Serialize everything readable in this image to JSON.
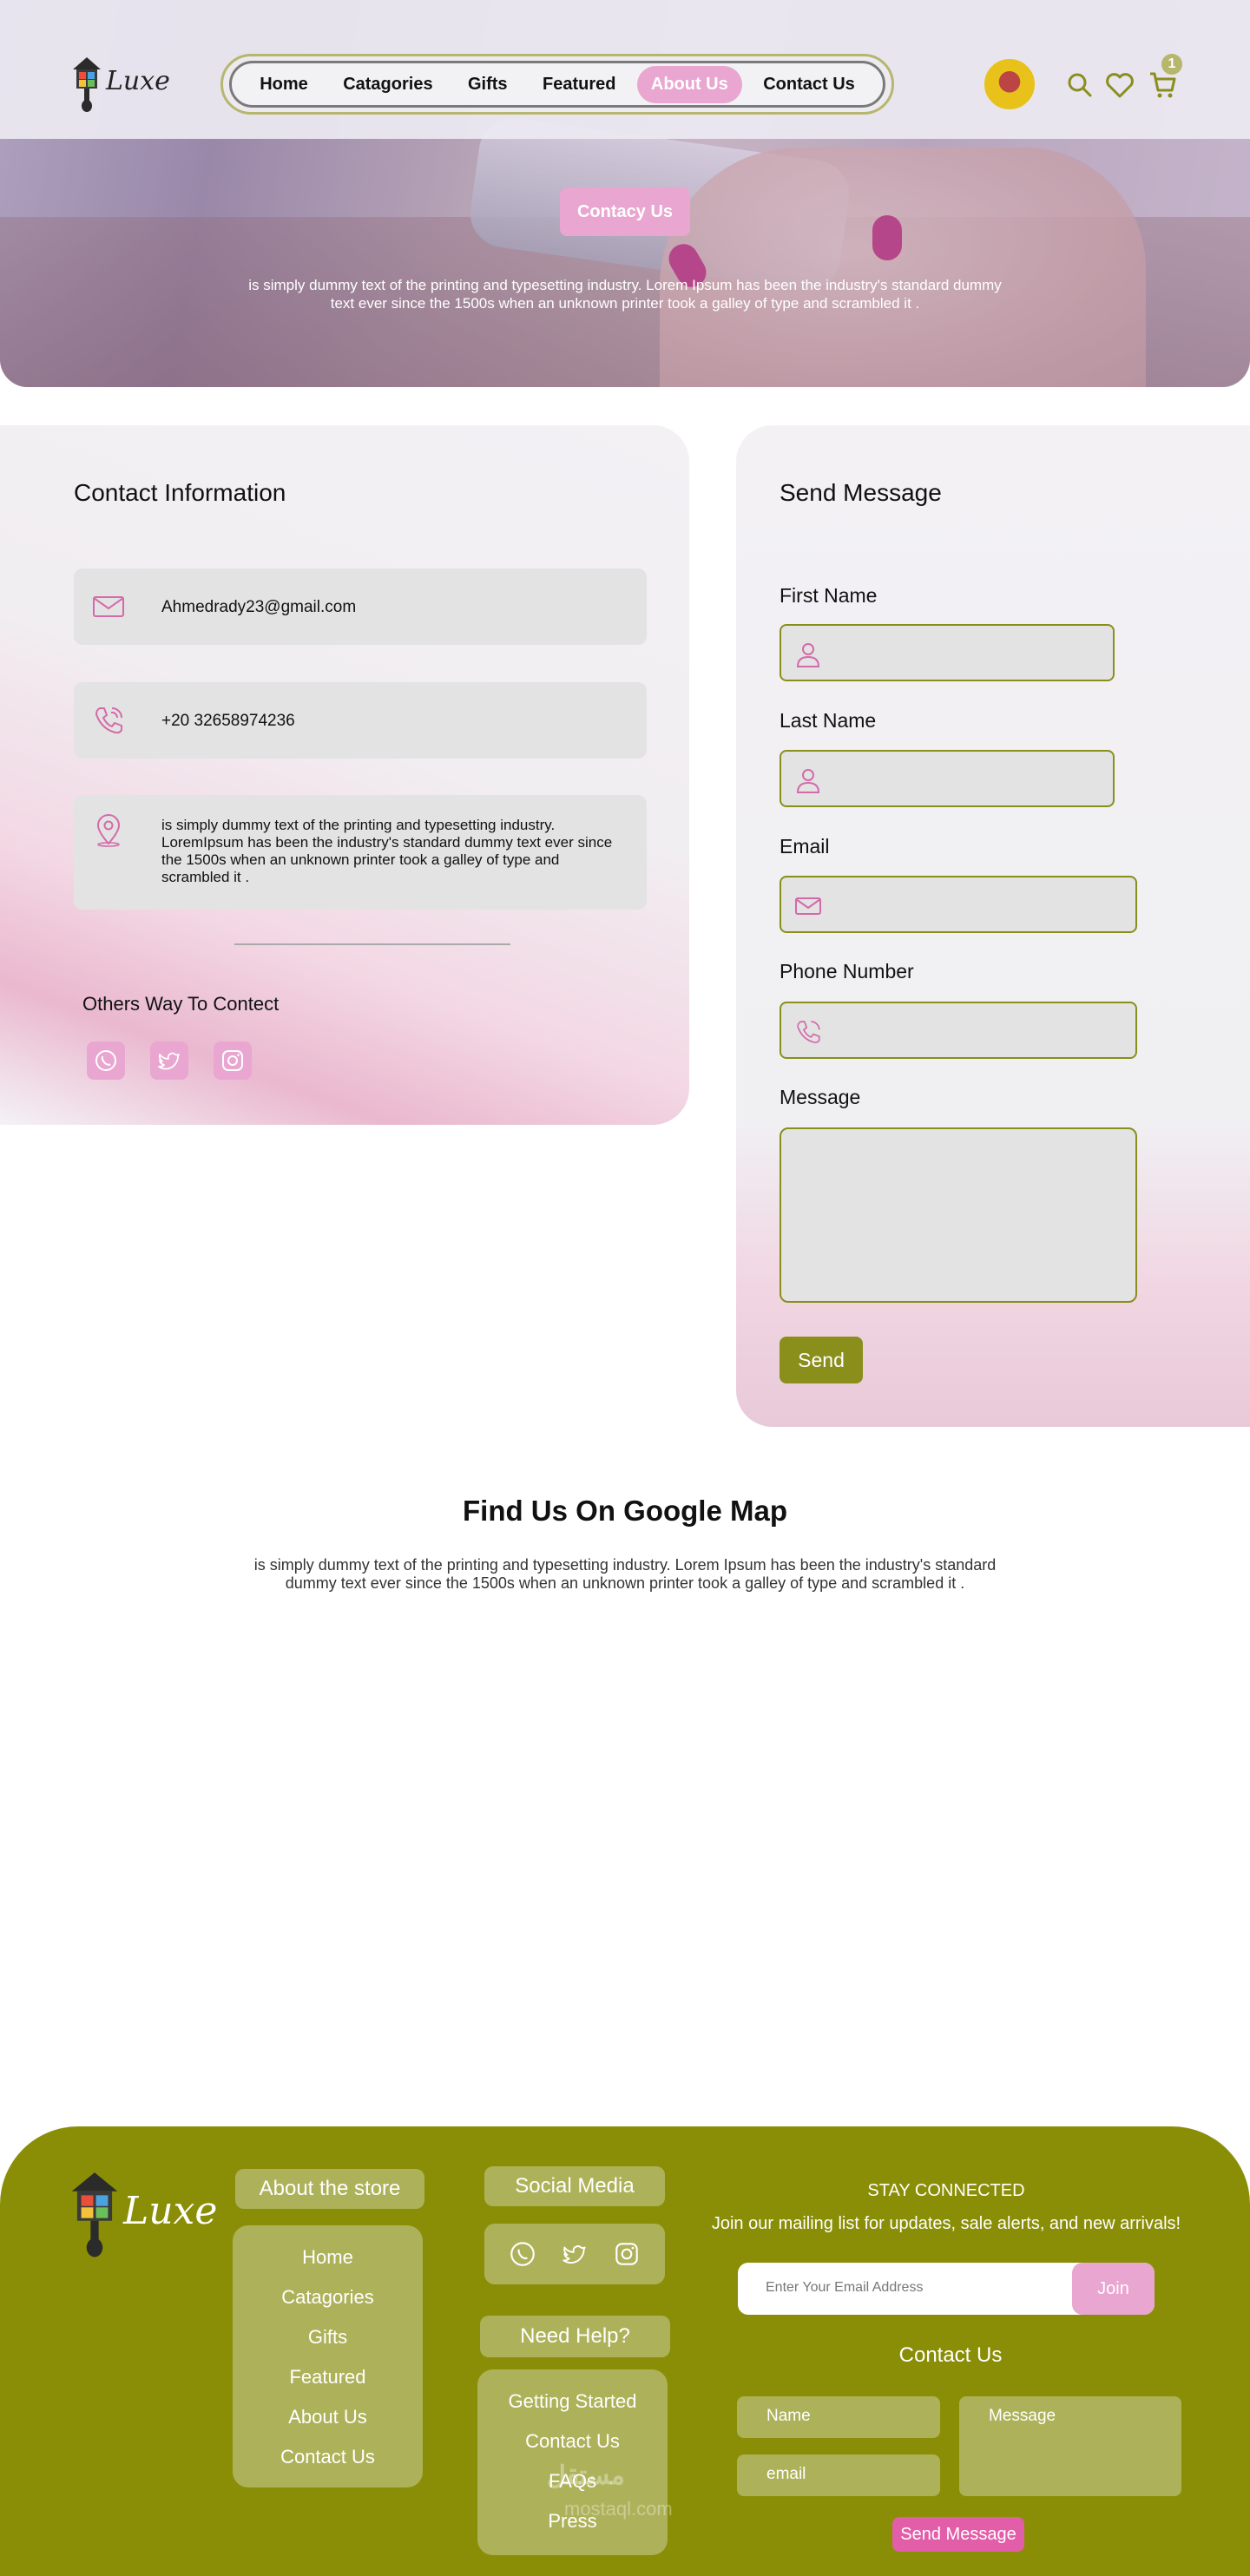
{
  "brand": {
    "name": "Luxe"
  },
  "nav": {
    "items": [
      "Home",
      "Catagories",
      "Gifts",
      "Featured",
      "About Us",
      "Contact Us"
    ],
    "active": "About Us"
  },
  "header_icons": {
    "cart_count": "1",
    "icons": [
      "search-icon",
      "heart-icon",
      "cart-icon"
    ]
  },
  "hero": {
    "button_label": "Contacy Us",
    "text": "is simply dummy text of the printing and typesetting industry. Lorem Ipsum has been the industry's standard dummy text ever since the 1500s when an unknown printer took a galley of type and scrambled it ."
  },
  "contact_info": {
    "title": "Contact Information",
    "email": "Ahmedrady23@gmail.com",
    "phone": "+20 32658974236",
    "address": "is simply dummy text of the printing and typesetting industry. LoremIpsum has been the industry's standard dummy text ever since the 1500s when an unknown printer took a galley of type and scrambled it .",
    "others_title": "Others Way To Contect",
    "social_icons": [
      "whatsapp-icon",
      "twitter-icon",
      "instagram-icon"
    ]
  },
  "send_message": {
    "title": "Send Message",
    "fields": {
      "first_name": "First Name",
      "last_name": "Last Name",
      "email": "Email",
      "phone": "Phone Number",
      "message": "Message"
    },
    "button_label": "Send"
  },
  "map": {
    "title": "Find Us On Google Map",
    "text": "is simply dummy text of the printing and typesetting industry. Lorem Ipsum has been the industry's standard dummy text ever since the 1500s when an unknown printer took a galley of type and scrambled it ."
  },
  "footer": {
    "brand": "Luxe",
    "about_title": "About the store",
    "about_links": [
      "Home",
      "Catagories",
      "Gifts",
      "Featured",
      "About Us",
      "Contact Us"
    ],
    "social_title": "Social Media",
    "help_title": "Need Help?",
    "help_links": [
      "Getting Started",
      "Contact Us",
      "FAQs",
      "Press"
    ],
    "stay_title": "STAY CONNECTED",
    "stay_text": "Join our mailing list for updates, sale alerts, and new arrivals!",
    "email_placeholder": "Enter Your Email Address",
    "join_label": "Join",
    "contact_title": "Contact Us",
    "name_placeholder": "Name",
    "email_field_placeholder": "email",
    "message_placeholder": "Message",
    "send_label": "Send Message",
    "watermark": "مستقل",
    "watermark_url": "mostaql.com"
  },
  "colors": {
    "olive": "#8a8e06",
    "olive_light": "#adb25a",
    "pink": "#e9a6d0",
    "pink_strong": "#e35ea9",
    "input_border": "#8a8e1b"
  }
}
